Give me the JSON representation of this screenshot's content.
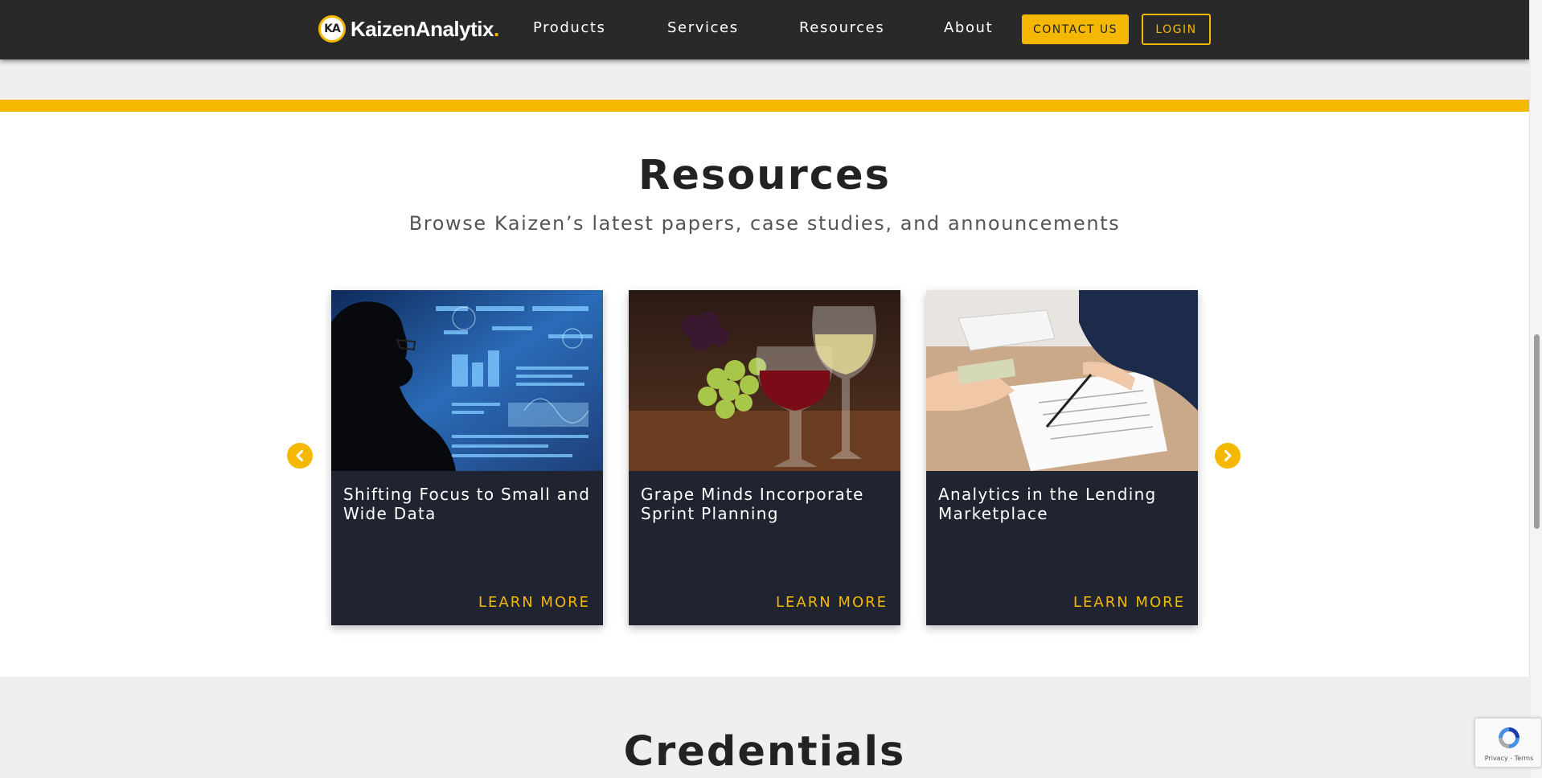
{
  "nav": {
    "logo_text": "KaizenAnalytix",
    "logo_dot": ".",
    "logo_mark": "KA",
    "links": [
      "Products",
      "Services",
      "Resources",
      "About"
    ],
    "contact_label": "CONTACT US",
    "login_label": "LOGIN"
  },
  "resources": {
    "title": "Resources",
    "subtitle": "Browse Kaizen’s latest papers, case studies, and announcements",
    "cards": [
      {
        "title": "Shifting Focus to Small and Wide Data",
        "link": "LEARN MORE",
        "image": "woman-silhouette-data-screens"
      },
      {
        "title": "Grape Minds Incorporate Sprint Planning",
        "link": "LEARN MORE",
        "image": "wine-glasses-and-grapes"
      },
      {
        "title": "Analytics in the Lending Marketplace",
        "link": "LEARN MORE",
        "image": "hands-signing-loan-document"
      }
    ],
    "prev_icon": "chevron-left-icon",
    "next_icon": "chevron-right-icon"
  },
  "credentials": {
    "title": "Credentials"
  },
  "recaptcha": {
    "text": "Privacy - Terms"
  },
  "colors": {
    "accent": "#f5b800",
    "nav_bg": "#292929",
    "card_bg": "#1f2430"
  }
}
